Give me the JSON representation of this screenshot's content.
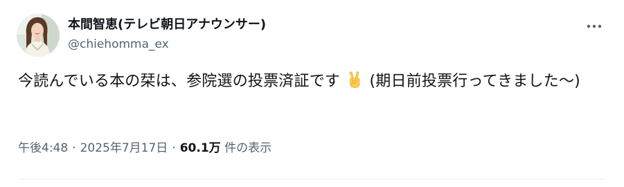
{
  "author": {
    "display_name": "本間智恵(テレビ朝日アナウンサー)",
    "handle": "@chiehomma_ex",
    "avatar_icon": "profile-photo"
  },
  "menu": {
    "more_icon": "more-horizontal-icon"
  },
  "post": {
    "text_before_emoji": "今読んでいる本の栞は、参院選の投票済証です",
    "emoji": "victory-hand-emoji",
    "text_after_emoji": "(期日前投票行ってきました〜)"
  },
  "meta": {
    "time": "午後4:48",
    "separator": "·",
    "date": "2025年7月17日",
    "views_count": "60.1万",
    "views_label": "件の表示"
  },
  "colors": {
    "text_primary": "#0f1419",
    "text_secondary": "#536471",
    "divider": "#eff3f4"
  }
}
